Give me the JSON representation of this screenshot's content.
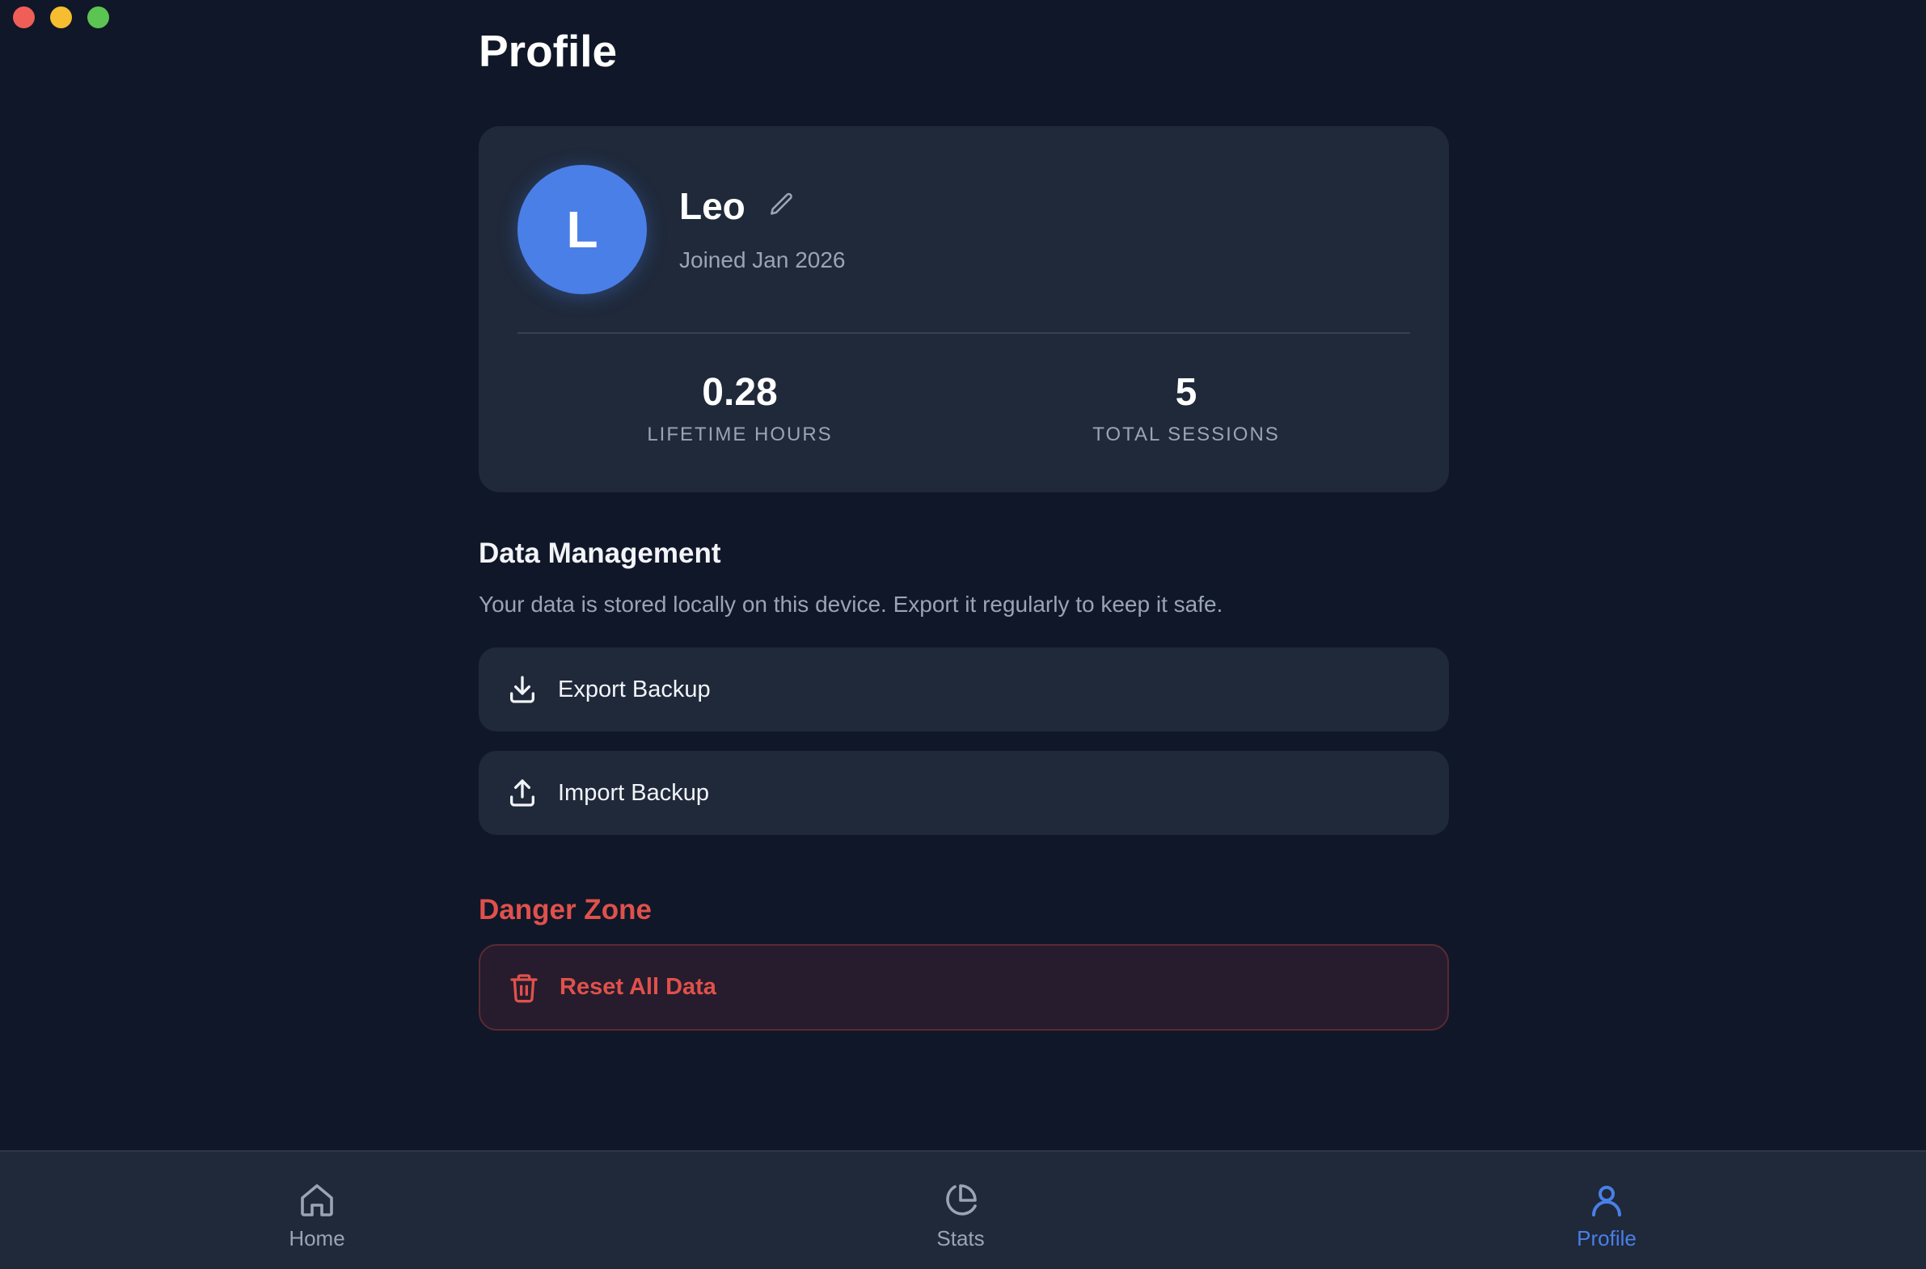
{
  "page": {
    "title": "Profile"
  },
  "profile": {
    "avatar_initial": "L",
    "name": "Leo",
    "joined": "Joined Jan 2026",
    "stats": [
      {
        "value": "0.28",
        "label": "LIFETIME HOURS"
      },
      {
        "value": "5",
        "label": "TOTAL SESSIONS"
      }
    ]
  },
  "data_management": {
    "title": "Data Management",
    "description": "Your data is stored locally on this device. Export it regularly to keep it safe.",
    "export_label": "Export Backup",
    "import_label": "Import Backup"
  },
  "danger_zone": {
    "title": "Danger Zone",
    "reset_label": "Reset All Data"
  },
  "nav": {
    "items": [
      {
        "label": "Home",
        "icon": "home-icon",
        "active": false
      },
      {
        "label": "Stats",
        "icon": "pie-chart-icon",
        "active": false
      },
      {
        "label": "Profile",
        "icon": "user-icon",
        "active": true
      }
    ]
  },
  "colors": {
    "background": "#101728",
    "card": "#1f293a",
    "accent": "#4a7fe8",
    "danger": "#e0514b",
    "muted_text": "#9aa4b4"
  }
}
